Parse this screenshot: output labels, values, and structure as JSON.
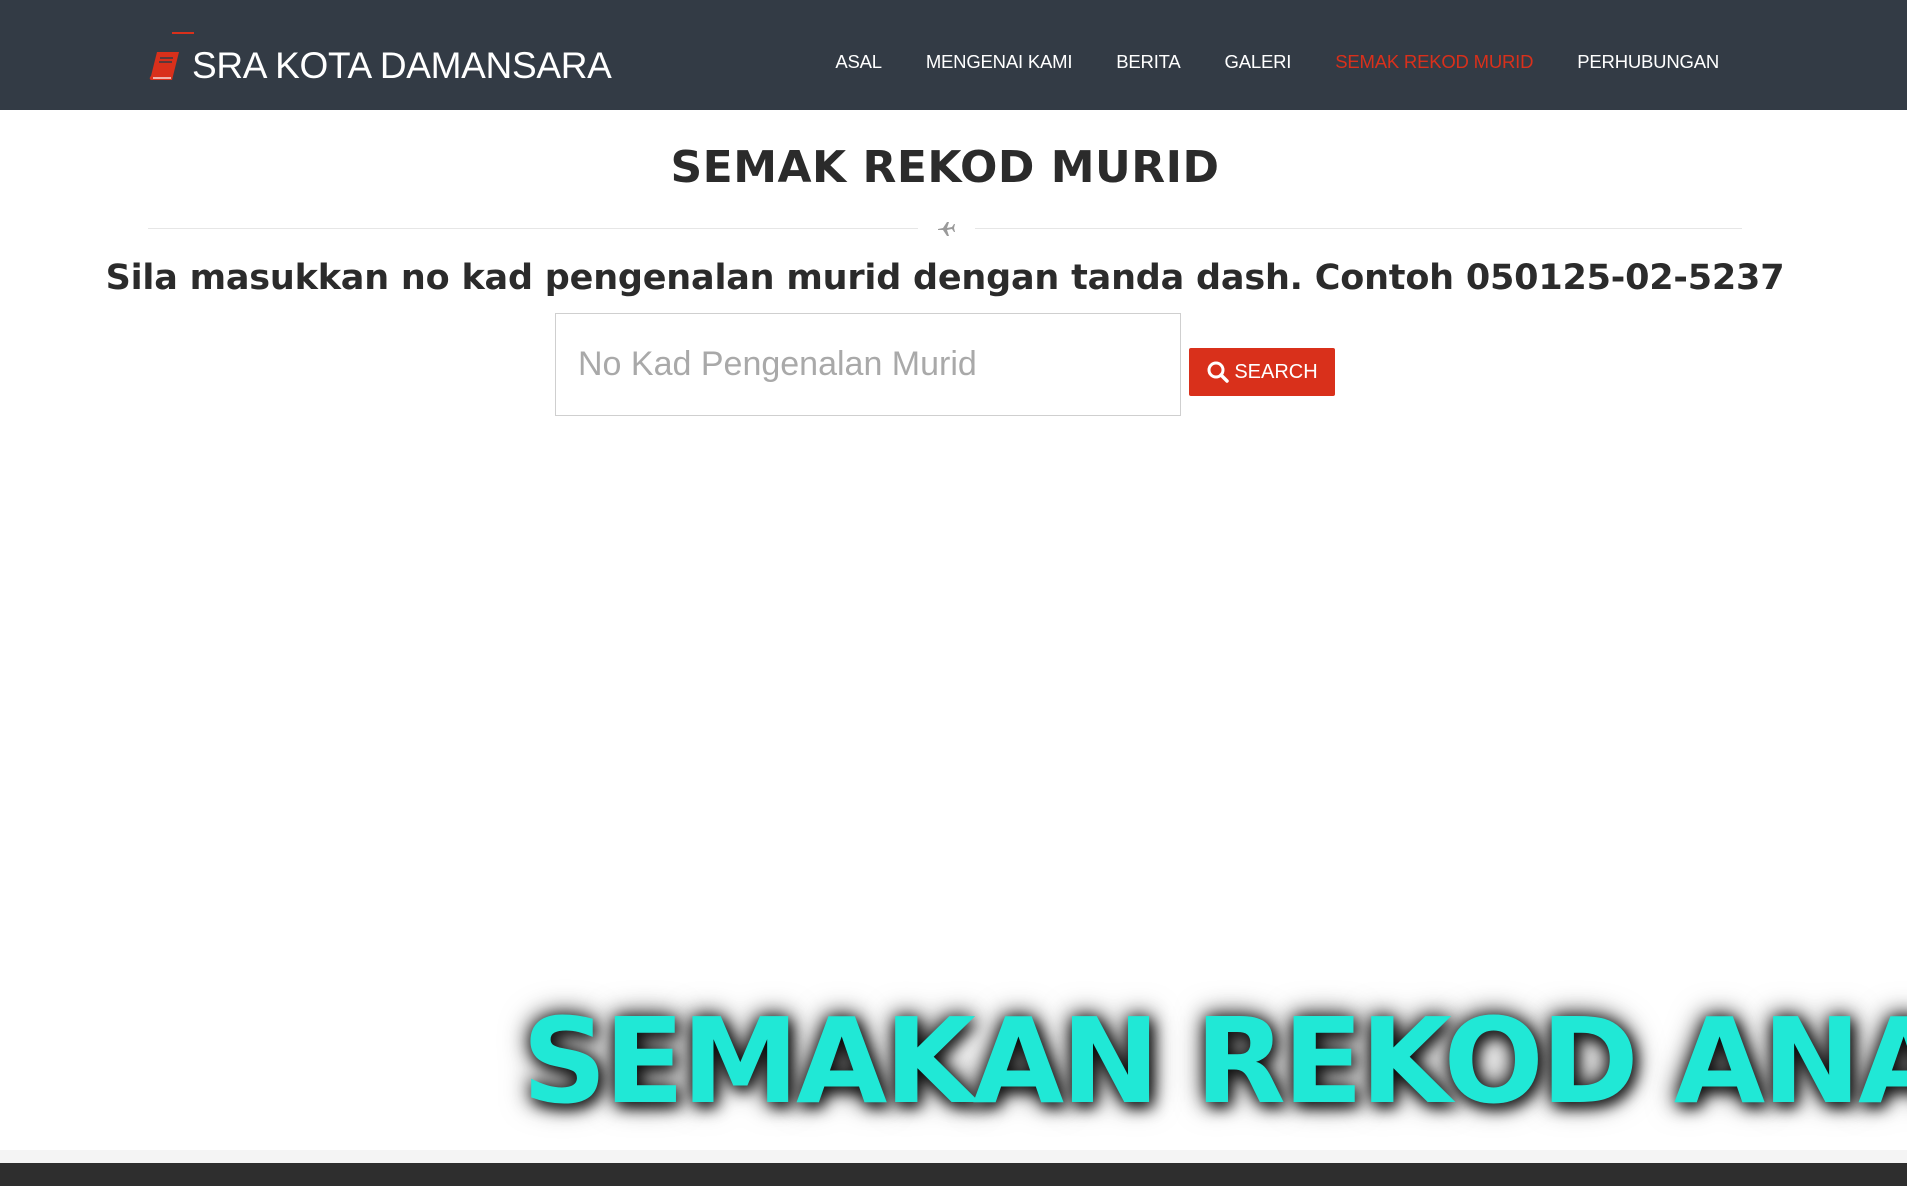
{
  "navbar": {
    "brand_text": "SRA KOTA DAMANSARA",
    "brand_icon": "book-icon",
    "items": [
      {
        "label": "ASAL",
        "active": false
      },
      {
        "label": "MENGENAI KAMI",
        "active": false
      },
      {
        "label": "BERITA",
        "active": false
      },
      {
        "label": "GALERI",
        "active": false
      },
      {
        "label": "SEMAK REKOD MURID",
        "active": true
      },
      {
        "label": "PERHUBUNGAN",
        "active": false
      }
    ]
  },
  "main": {
    "title": "SEMAK REKOD MURID",
    "divider_icon": "plane-icon",
    "instruction": "Sila masukkan no kad pengenalan murid dengan tanda dash. Contoh 050125-02-5237",
    "search": {
      "placeholder": "No Kad Pengenalan Murid",
      "value": "",
      "button_label": "SEARCH",
      "button_icon": "search-icon"
    }
  },
  "overlay": {
    "caption": "SEMAKAN REKOD ANAK"
  },
  "colors": {
    "navbar_bg": "#333b45",
    "accent": "#d9301b",
    "overlay_text": "#20e8d6"
  }
}
